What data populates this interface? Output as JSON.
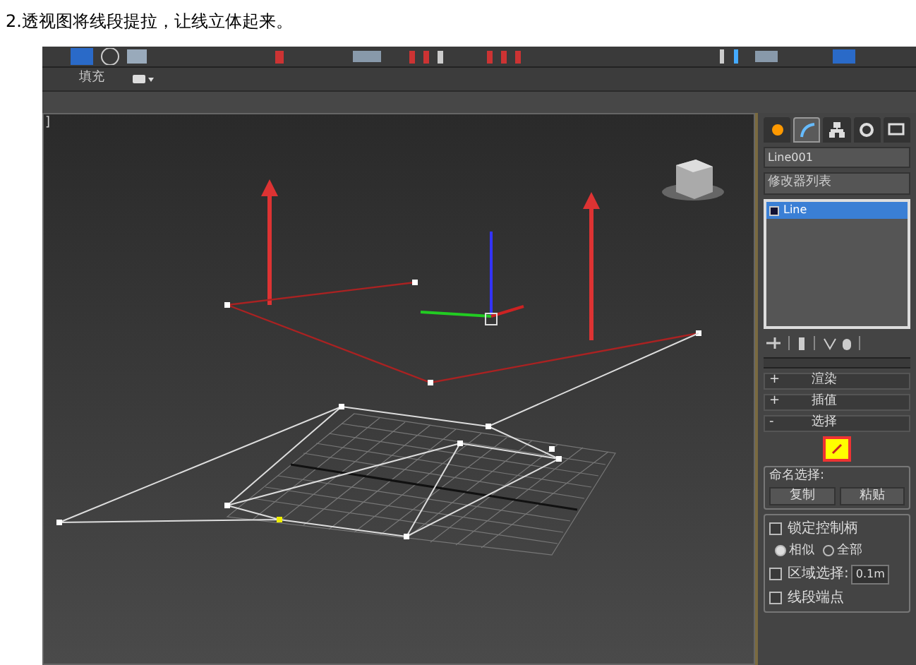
{
  "caption": "2.透视图将线段提拉，让线立体起来。",
  "ribbon": {
    "label": "填充"
  },
  "viewport": {
    "corner_label": "]"
  },
  "command_panel": {
    "tabs": [
      {
        "selected": false
      },
      {
        "selected": true
      },
      {
        "selected": false
      },
      {
        "selected": false
      },
      {
        "selected": false
      }
    ],
    "object_name": "Line001",
    "modifier_list": "修改器列表",
    "stack": [
      {
        "label": "Line",
        "selected": true
      }
    ],
    "rollouts": [
      {
        "sign": "+",
        "title": "渲染"
      },
      {
        "sign": "+",
        "title": "插值"
      },
      {
        "sign": "-",
        "title": "选择"
      }
    ],
    "vertex_mode": {
      "selected": true
    },
    "named_selection": {
      "label": "命名选择:",
      "buttons": [
        "复制",
        "粘贴"
      ]
    },
    "lock_handles": {
      "label": "锁定控制柄",
      "checked": false
    },
    "radios": [
      {
        "label": "相似",
        "selected": true
      },
      {
        "label": "全部",
        "selected": false
      }
    ],
    "area_selection": {
      "label": "区域选择:",
      "checked": false,
      "value": "0.1m"
    },
    "segment_end": {
      "label": "线段端点",
      "checked": false
    }
  }
}
